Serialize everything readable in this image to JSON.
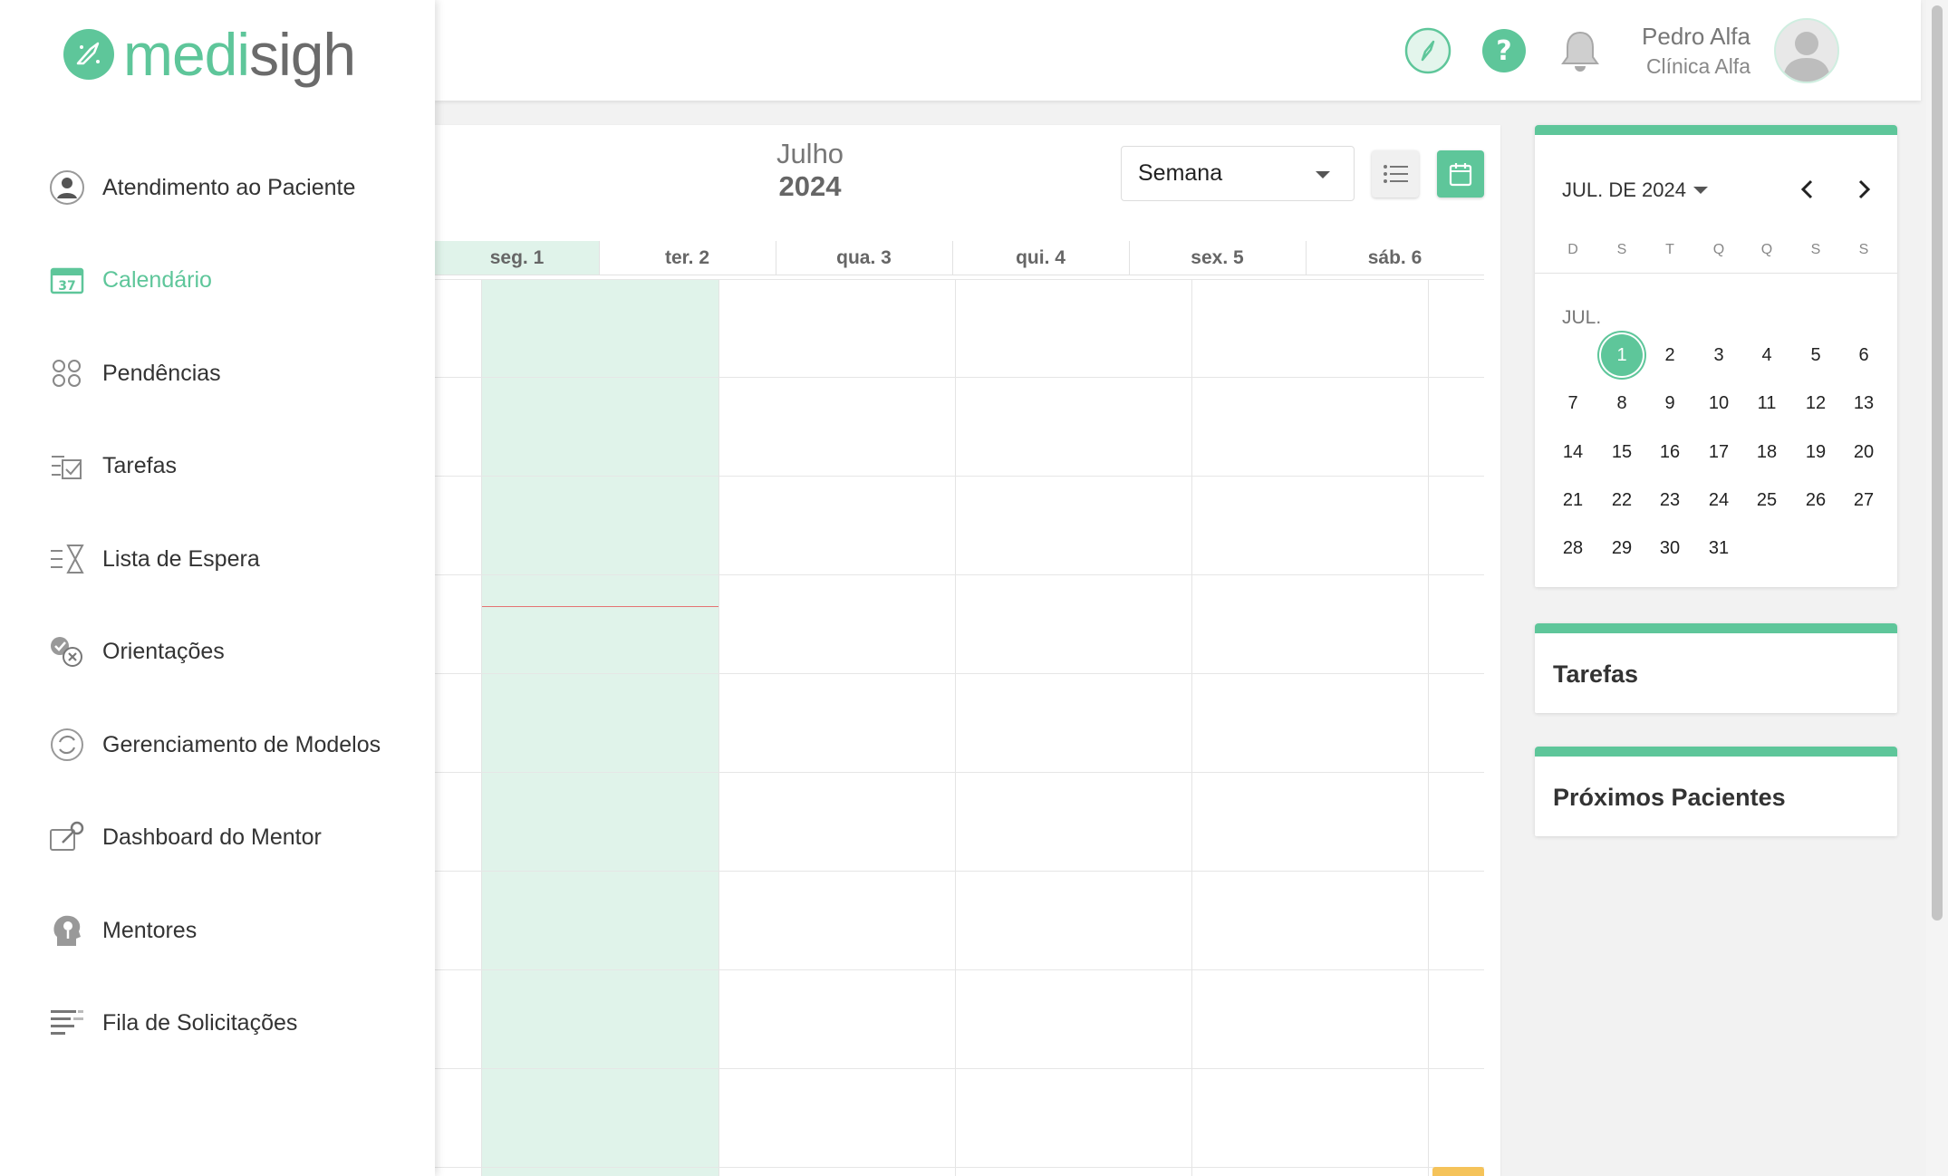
{
  "brand": {
    "part1": "medi",
    "part2": "sigh"
  },
  "header": {
    "user_name": "Pedro Alfa",
    "clinic_name": "Clínica Alfa",
    "icons": [
      "compass-icon",
      "help-icon",
      "bell-icon",
      "avatar"
    ]
  },
  "sidebar": {
    "items": [
      {
        "label": "Atendimento ao Paciente",
        "icon": "patient-care-icon",
        "active": false
      },
      {
        "label": "Calendário",
        "icon": "calendar-icon",
        "active": true
      },
      {
        "label": "Pendências",
        "icon": "pending-icon",
        "active": false
      },
      {
        "label": "Tarefas",
        "icon": "tasks-icon",
        "active": false
      },
      {
        "label": "Lista de Espera",
        "icon": "hourglass-list-icon",
        "active": false
      },
      {
        "label": "Orientações",
        "icon": "check-x-icon",
        "active": false
      },
      {
        "label": "Gerenciamento de Modelos",
        "icon": "refresh-doc-icon",
        "active": false
      },
      {
        "label": "Dashboard do Mentor",
        "icon": "key-dashboard-icon",
        "active": false
      },
      {
        "label": "Mentores",
        "icon": "mentor-head-icon",
        "active": false
      },
      {
        "label": "Fila de Solicitações",
        "icon": "queue-list-icon",
        "active": false
      }
    ]
  },
  "calendar": {
    "month": "Julho",
    "year": "2024",
    "view": "Semana",
    "days": [
      {
        "label": "seg. 1",
        "today": true
      },
      {
        "label": "ter. 2",
        "today": false
      },
      {
        "label": "qua. 3",
        "today": false
      },
      {
        "label": "qui. 4",
        "today": false
      },
      {
        "label": "sex. 5",
        "today": false
      },
      {
        "label": "sáb. 6",
        "today": false
      }
    ]
  },
  "mini_calendar": {
    "title": "JUL. DE 2024",
    "month_label": "JUL.",
    "weekdays": [
      "D",
      "S",
      "T",
      "Q",
      "Q",
      "S",
      "S"
    ],
    "selected_day": 1,
    "first_weekday": 1,
    "days_in_month": 31
  },
  "panels": {
    "tasks_title": "Tarefas",
    "next_patients_title": "Próximos Pacientes"
  },
  "colors": {
    "accent": "#5ec69a",
    "today_bg": "#e0f3ea",
    "now_line": "#e57373",
    "event": "#f5c35a"
  }
}
